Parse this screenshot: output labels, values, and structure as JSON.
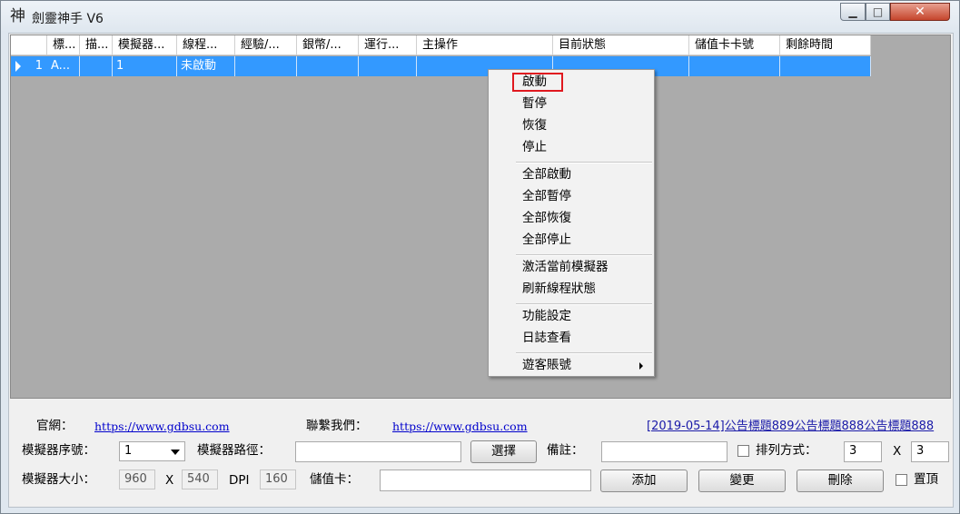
{
  "window": {
    "title": "劍靈神手 V6",
    "icon_glyph": "神"
  },
  "grid": {
    "columns": [
      "標...",
      "描...",
      "模擬器...",
      "線程...",
      "經驗/...",
      "銀幣/...",
      "運行...",
      "主操作",
      "目前狀態",
      "儲值卡卡號",
      "剩餘時間"
    ],
    "row": {
      "number": "1",
      "cells": [
        "A...",
        "",
        "1",
        "未啟動",
        "",
        "",
        "",
        "",
        "",
        "",
        ""
      ]
    }
  },
  "context_menu": {
    "group1": [
      "啟動",
      "暫停",
      "恢復",
      "停止"
    ],
    "group2": [
      "全部啟動",
      "全部暫停",
      "全部恢復",
      "全部停止"
    ],
    "group3": [
      "激活當前模擬器",
      "刷新線程狀態"
    ],
    "group4": [
      "功能設定",
      "日誌查看"
    ],
    "group5": [
      "遊客賬號"
    ]
  },
  "footer": {
    "official_label": "官網：",
    "official_url": "https://www.gdbsu.com",
    "contact_label": "聯繫我們：",
    "contact_url": "https://www.gdbsu.com",
    "announcement": "[2019-05-14]公告標題889公告標題888公告標題888",
    "emulator_index_label": "模擬器序號：",
    "emulator_index_value": "1",
    "emulator_path_label": "模擬器路徑：",
    "emulator_path_value": "",
    "choose_button": "選擇",
    "remark_label": "備註：",
    "remark_value": "",
    "arrange_label": "排列方式：",
    "arrange_cols": "3",
    "arrange_x": "X",
    "arrange_rows": "3",
    "emulator_size_label": "模擬器大小：",
    "width_value": "960",
    "size_x": "X",
    "height_value": "540",
    "dpi_label": "DPI",
    "dpi_value": "160",
    "card_label": "儲值卡：",
    "card_value": "",
    "add_button": "添加",
    "change_button": "變更",
    "delete_button": "刪除",
    "pin_label": "置頂"
  }
}
